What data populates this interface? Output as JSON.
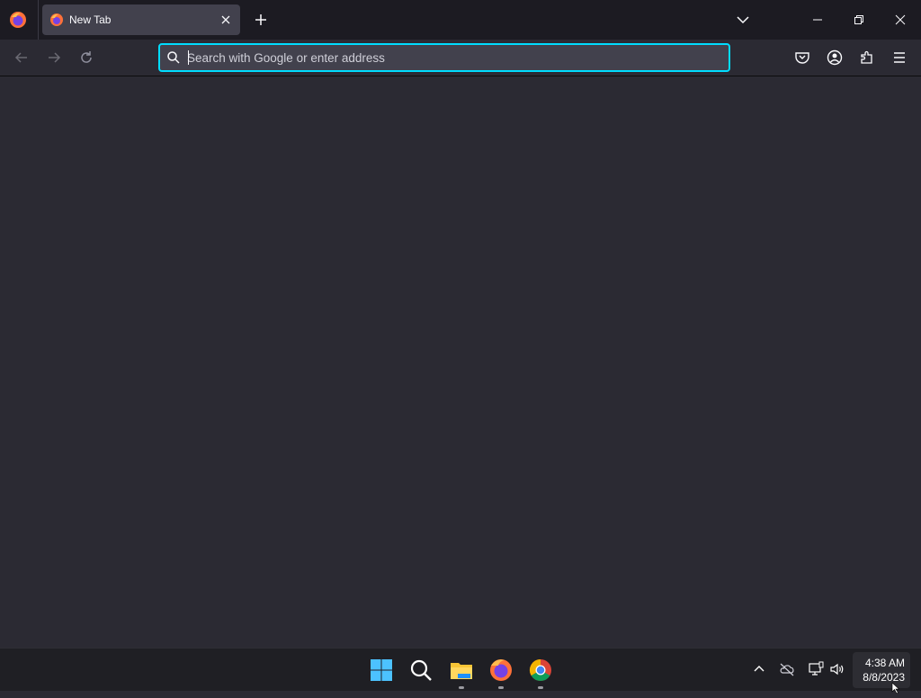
{
  "window": {
    "tab": {
      "title": "New Tab"
    }
  },
  "urlbar": {
    "placeholder": "Search with Google or enter address",
    "value": ""
  },
  "toolbar_icons": [
    "pocket-icon",
    "account-icon",
    "extensions-icon",
    "menu-icon"
  ],
  "nav_icons": [
    "back-arrow-icon",
    "forward-arrow-icon",
    "reload-icon"
  ],
  "taskbar": {
    "apps": [
      "windows-start-icon",
      "search-icon",
      "file-explorer-icon",
      "firefox-icon",
      "chrome-icon"
    ],
    "clock": {
      "time": "4:38 AM",
      "date": "8/8/2023"
    }
  },
  "colors": {
    "accent": "#00ddff",
    "chrome_bg": "#1c1b22",
    "toolbar_bg": "#2b2a33",
    "tab_bg": "#42414d"
  }
}
